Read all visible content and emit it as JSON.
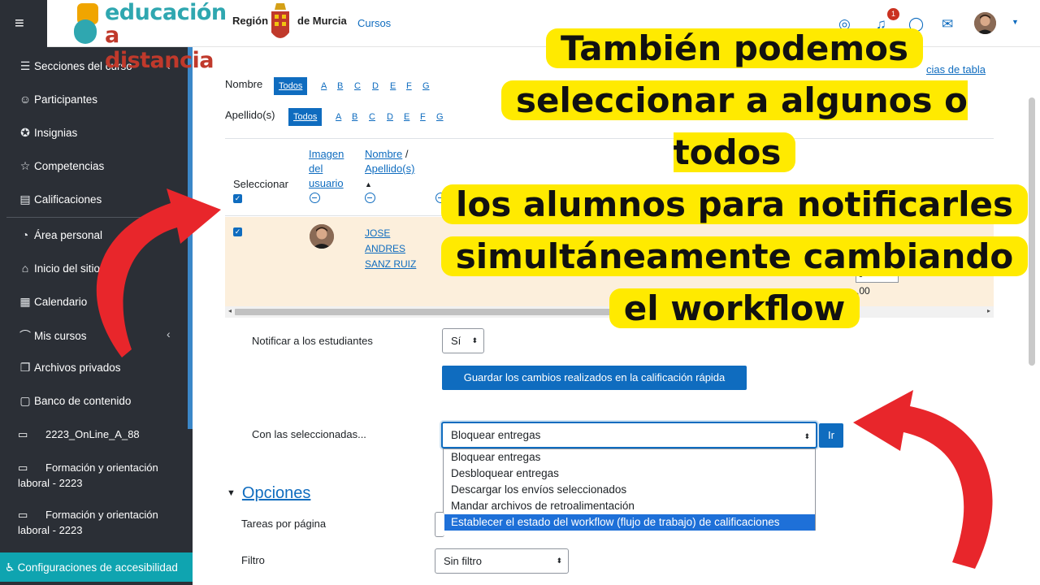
{
  "header": {
    "logo_line1": "educación",
    "logo_line2": "a distancia",
    "region_label": "Región",
    "murcia_label": "de Murcia",
    "cursos_link": "Cursos",
    "notification_count": "1"
  },
  "sidebar": {
    "items": [
      {
        "label": "Secciones del curso",
        "icon": "list-icon"
      },
      {
        "label": "Participantes",
        "icon": "users-icon"
      },
      {
        "label": "Insignias",
        "icon": "badge-icon"
      },
      {
        "label": "Competencias",
        "icon": "star-icon"
      },
      {
        "label": "Calificaciones",
        "icon": "table-icon"
      },
      {
        "label": "Área personal",
        "icon": "gauge-icon"
      },
      {
        "label": "Inicio del sitio",
        "icon": "home-icon"
      },
      {
        "label": "Calendario",
        "icon": "calendar-icon"
      },
      {
        "label": "Mis cursos",
        "icon": "graduation-cap-icon"
      },
      {
        "label": "Archivos privados",
        "icon": "file-icon"
      },
      {
        "label": "Banco de contenido",
        "icon": "clipboard-icon"
      }
    ],
    "folders": [
      "2223_OnLine_A_88",
      "Formación y orientación laboral - 2223",
      "Formación y orientación laboral - 2223"
    ],
    "accessibility": "Configuraciones de accesibilidad"
  },
  "filters": {
    "nombre_label": "Nombre",
    "apellido_label": "Apellido(s)",
    "todos": "Todos",
    "letters_nombre": [
      "A",
      "B",
      "C",
      "D",
      "E",
      "F",
      "G"
    ],
    "letters_apellido": [
      "A",
      "B",
      "C",
      "D",
      "E",
      "F",
      "G"
    ],
    "reset_link": "cias de tabla"
  },
  "table": {
    "col_select": "Seleccionar",
    "col_image": "Imagen del usuario",
    "col_name_a": "Nombre",
    "col_name_b": "Apellido(s)",
    "sort_arrow": "▲",
    "student_name": "JOSE ANDRES SANZ RUIZ",
    "grade_value": "0",
    "grade_max": ",00"
  },
  "form": {
    "notify_label": "Notificar a los estudiantes",
    "notify_value": "Sí",
    "save_button": "Guardar los cambios realizados en la calificación rápida",
    "with_selected_label": "Con las seleccionadas...",
    "with_selected_value": "Bloquear entregas",
    "go_button": "Ir",
    "options": [
      "Bloquear entregas",
      "Desbloquear entregas",
      "Descargar los envíos seleccionados",
      "Mandar archivos de retroalimentación",
      "Establecer el estado del workflow (flujo de trabajo) de calificaciones"
    ],
    "selected_option_index": 4
  },
  "opciones": {
    "title": "Opciones",
    "per_page_label": "Tareas por página",
    "filter_label": "Filtro",
    "filter_value": "Sin filtro"
  },
  "callout": {
    "line1": "También podemos",
    "line2": "seleccionar a algunos o todos",
    "line3": "los alumnos para notificarles",
    "line4": "simultáneamente cambiando",
    "line5": "el workflow"
  },
  "colors": {
    "sidebar_bg": "#2b2f36",
    "accent": "#0f6cbf",
    "highlight_row": "#fcefdc",
    "callout_bg": "#ffea00",
    "arrow": "#e8262b",
    "accessibility_bar": "#0fa4b0"
  }
}
